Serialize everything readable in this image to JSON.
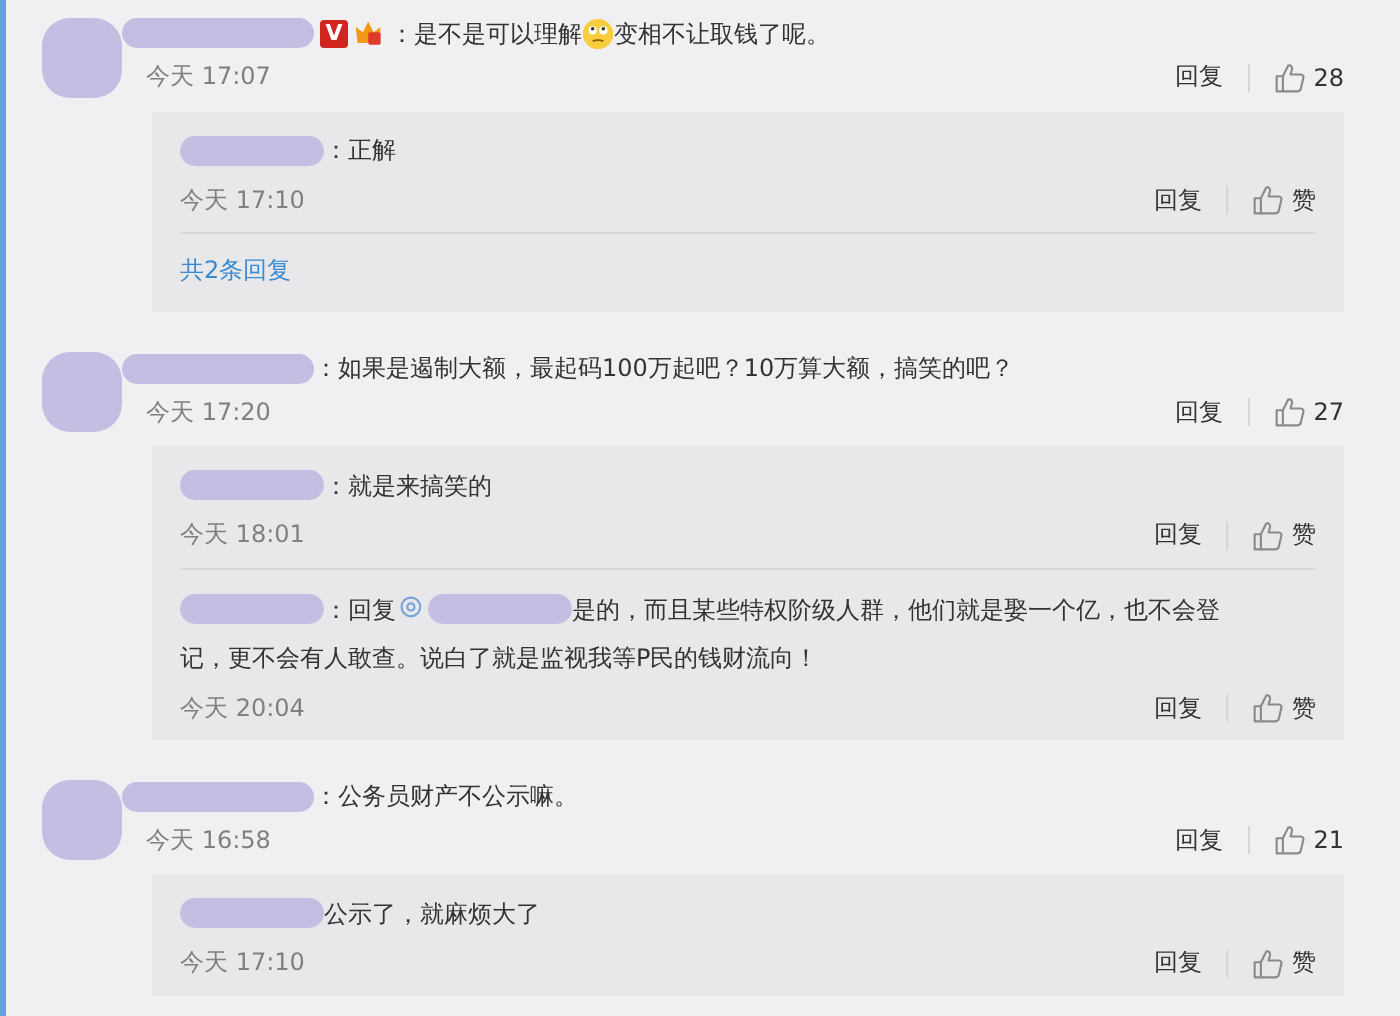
{
  "comments": [
    {
      "segments": [
        {
          "kind": "redaction"
        },
        {
          "kind": "badge",
          "text": "V"
        },
        {
          "kind": "crown"
        },
        {
          "kind": "text",
          "text": "：是不是可以理解"
        },
        {
          "kind": "emoji"
        },
        {
          "kind": "text",
          "text": "变相不让取钱了呢。"
        }
      ],
      "time": "今天 17:07",
      "reply": "回复",
      "likes": "28",
      "replies": [
        {
          "segments": [
            {
              "kind": "redaction"
            },
            {
              "kind": "text",
              "text": "：正解"
            }
          ],
          "time": "今天 17:10",
          "reply": "回复",
          "likes": "赞"
        }
      ],
      "more": "共2条回复"
    },
    {
      "segments": [
        {
          "kind": "redaction"
        },
        {
          "kind": "text",
          "text": "：如果是遏制大额，最起码100万起吧？10万算大额，搞笑的吧？"
        }
      ],
      "time": "今天 17:20",
      "reply": "回复",
      "likes": "27",
      "replies": [
        {
          "segments": [
            {
              "kind": "redaction"
            },
            {
              "kind": "text",
              "text": "：就是来搞笑的"
            }
          ],
          "time": "今天 18:01",
          "reply": "回复",
          "likes": "赞"
        },
        {
          "segments": [
            {
              "kind": "redaction"
            },
            {
              "kind": "text",
              "text": "：回复"
            },
            {
              "kind": "at"
            },
            {
              "kind": "redaction"
            },
            {
              "kind": "text",
              "text": "是的，而且某些特权阶级人群，他们就是娶一个亿，也不会登"
            },
            {
              "kind": "text",
              "text": "记，更不会有人敢查。说白了就是监视我等P民的钱财流向！"
            }
          ],
          "time": "今天 20:04",
          "reply": "回复",
          "likes": "赞"
        }
      ]
    },
    {
      "segments": [
        {
          "kind": "redaction"
        },
        {
          "kind": "text",
          "text": "：公务员财产不公示嘛。"
        }
      ],
      "time": "今天 16:58",
      "reply": "回复",
      "likes": "21",
      "replies": [
        {
          "segments": [
            {
              "kind": "redaction"
            },
            {
              "kind": "text",
              "text": "公示了，就麻烦大了"
            }
          ],
          "time": "今天 17:10",
          "reply": "回复",
          "likes": "赞"
        }
      ]
    }
  ]
}
